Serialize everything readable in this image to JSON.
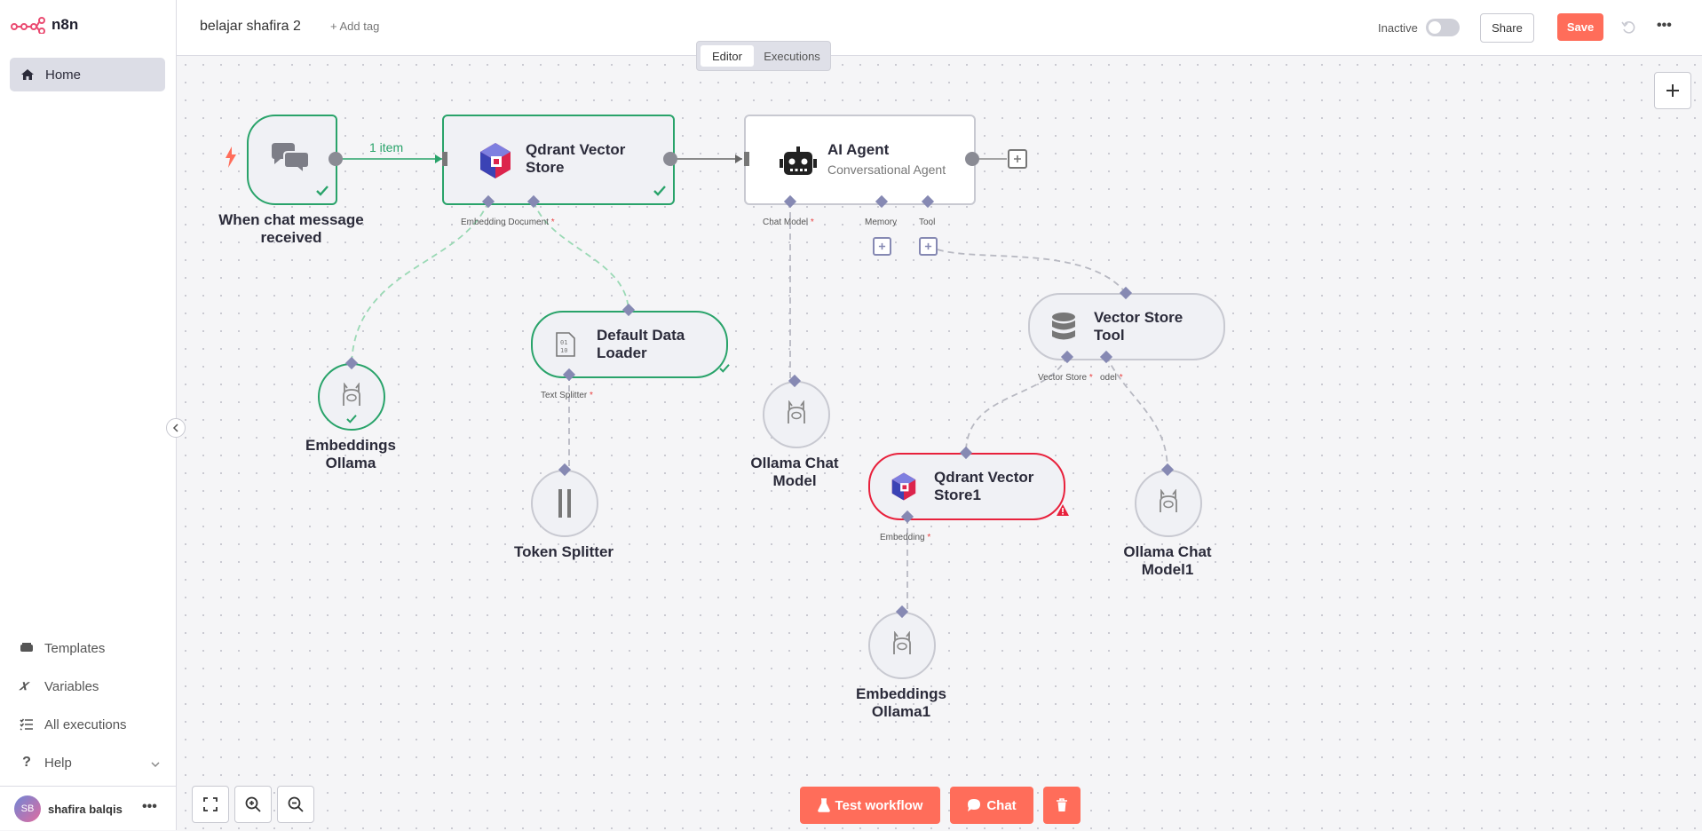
{
  "app": {
    "name": "n8n"
  },
  "sidebar": {
    "home_label": "Home",
    "items": [
      {
        "label": "Templates"
      },
      {
        "label": "Variables"
      },
      {
        "label": "All executions"
      },
      {
        "label": "Help"
      }
    ],
    "user": {
      "initials": "SB",
      "name": "shafira balqis"
    }
  },
  "header": {
    "workflow_name": "belajar shafira 2",
    "add_tag": "+ Add tag",
    "tabs": [
      "Editor",
      "Executions"
    ],
    "active_tab": "Editor",
    "status_label": "Inactive",
    "share_label": "Share",
    "save_label": "Save"
  },
  "nodes": {
    "chat_trigger": {
      "label": "When chat message received"
    },
    "qdrant1": {
      "label": "Qdrant Vector Store"
    },
    "ai_agent": {
      "label": "AI Agent",
      "subtitle": "Conversational Agent"
    },
    "default_loader": {
      "label": "Default Data Loader"
    },
    "embeddings_ollama": {
      "label": "Embeddings Ollama"
    },
    "token_splitter": {
      "label": "Token Splitter"
    },
    "ollama_chat": {
      "label": "Ollama Chat Model"
    },
    "vector_store_tool": {
      "label": "Vector Store Tool"
    },
    "qdrant2": {
      "label": "Qdrant Vector Store1"
    },
    "ollama_chat1": {
      "label": "Ollama Chat Model1"
    },
    "embeddings_ollama1": {
      "label": "Embeddings Ollama1"
    }
  },
  "connections": {
    "item_count": "1 item"
  },
  "ports": {
    "embedding_document": "Embedding Document",
    "chat_model": "Chat Model",
    "memory": "Memory",
    "tool": "Tool",
    "text_splitter": "Text Splitter",
    "vector_store": "Vector Store",
    "model": "odel",
    "embedding": "Embedding",
    "required_mark": "*"
  },
  "bottom_bar": {
    "test_workflow": "Test workflow",
    "chat": "Chat"
  },
  "colors": {
    "accent": "#ff6d5a",
    "success": "#29a36a",
    "error": "#e8213c",
    "port": "#8689b3"
  }
}
